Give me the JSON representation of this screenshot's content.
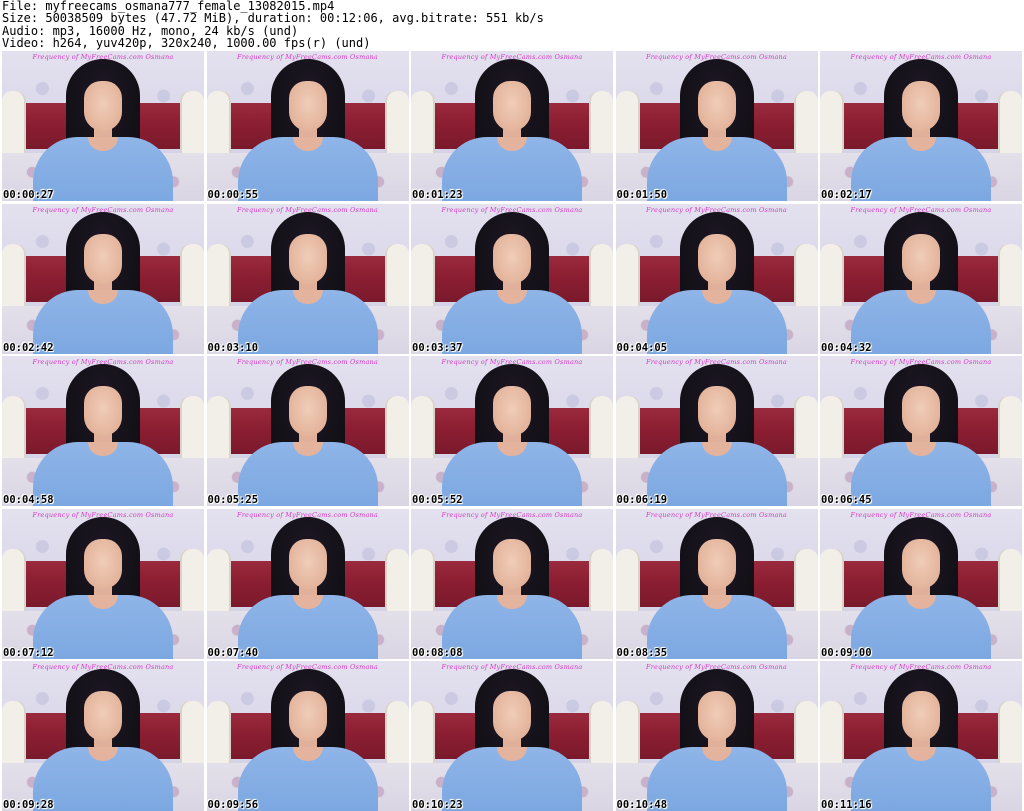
{
  "header": {
    "file": "File: myfreecams_osmana777_female_13082015.mp4",
    "size": "Size: 50038509 bytes (47.72 MiB), duration: 00:12:06, avg.bitrate: 551 kb/s",
    "audio": "Audio: mp3, 16000 Hz, mono, 24 kb/s (und)",
    "video": "Video: h264, yuv420p, 320x240, 1000.00 fps(r) (und)"
  },
  "watermark": "Frequency of MyFreeCams.com Osmana",
  "thumbnails": [
    {
      "time": "00:00:27"
    },
    {
      "time": "00:00:55"
    },
    {
      "time": "00:01:23"
    },
    {
      "time": "00:01:50"
    },
    {
      "time": "00:02:17"
    },
    {
      "time": "00:02:42"
    },
    {
      "time": "00:03:10"
    },
    {
      "time": "00:03:37"
    },
    {
      "time": "00:04:05"
    },
    {
      "time": "00:04:32"
    },
    {
      "time": "00:04:58"
    },
    {
      "time": "00:05:25"
    },
    {
      "time": "00:05:52"
    },
    {
      "time": "00:06:19"
    },
    {
      "time": "00:06:45"
    },
    {
      "time": "00:07:12"
    },
    {
      "time": "00:07:40"
    },
    {
      "time": "00:08:08"
    },
    {
      "time": "00:08:35"
    },
    {
      "time": "00:09:00"
    },
    {
      "time": "00:09:28"
    },
    {
      "time": "00:09:56"
    },
    {
      "time": "00:10:23"
    },
    {
      "time": "00:10:48"
    },
    {
      "time": "00:11:16"
    }
  ]
}
